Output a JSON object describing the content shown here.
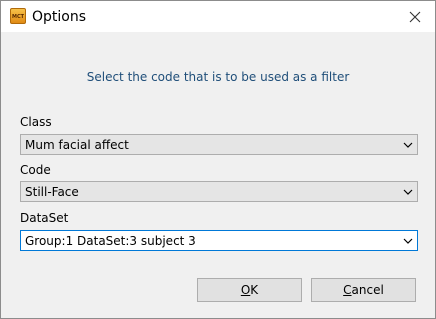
{
  "window": {
    "title": "Options",
    "app_icon_text": "MCT"
  },
  "prompt": "Select the code that is to be used as a filter",
  "fields": {
    "class": {
      "label": "Class",
      "value": "Mum facial affect"
    },
    "code": {
      "label": "Code",
      "value": "Still-Face"
    },
    "dataset": {
      "label": "DataSet",
      "value": "Group:1 DataSet:3 subject 3"
    }
  },
  "buttons": {
    "ok": {
      "accel": "O",
      "rest": "K"
    },
    "cancel": {
      "accel": "C",
      "rest": "ancel"
    }
  },
  "colors": {
    "prompt_text": "#1f4e79",
    "focus_border": "#0078d7"
  },
  "icons": [
    "app-icon",
    "close-icon",
    "chevron-down-icon"
  ]
}
